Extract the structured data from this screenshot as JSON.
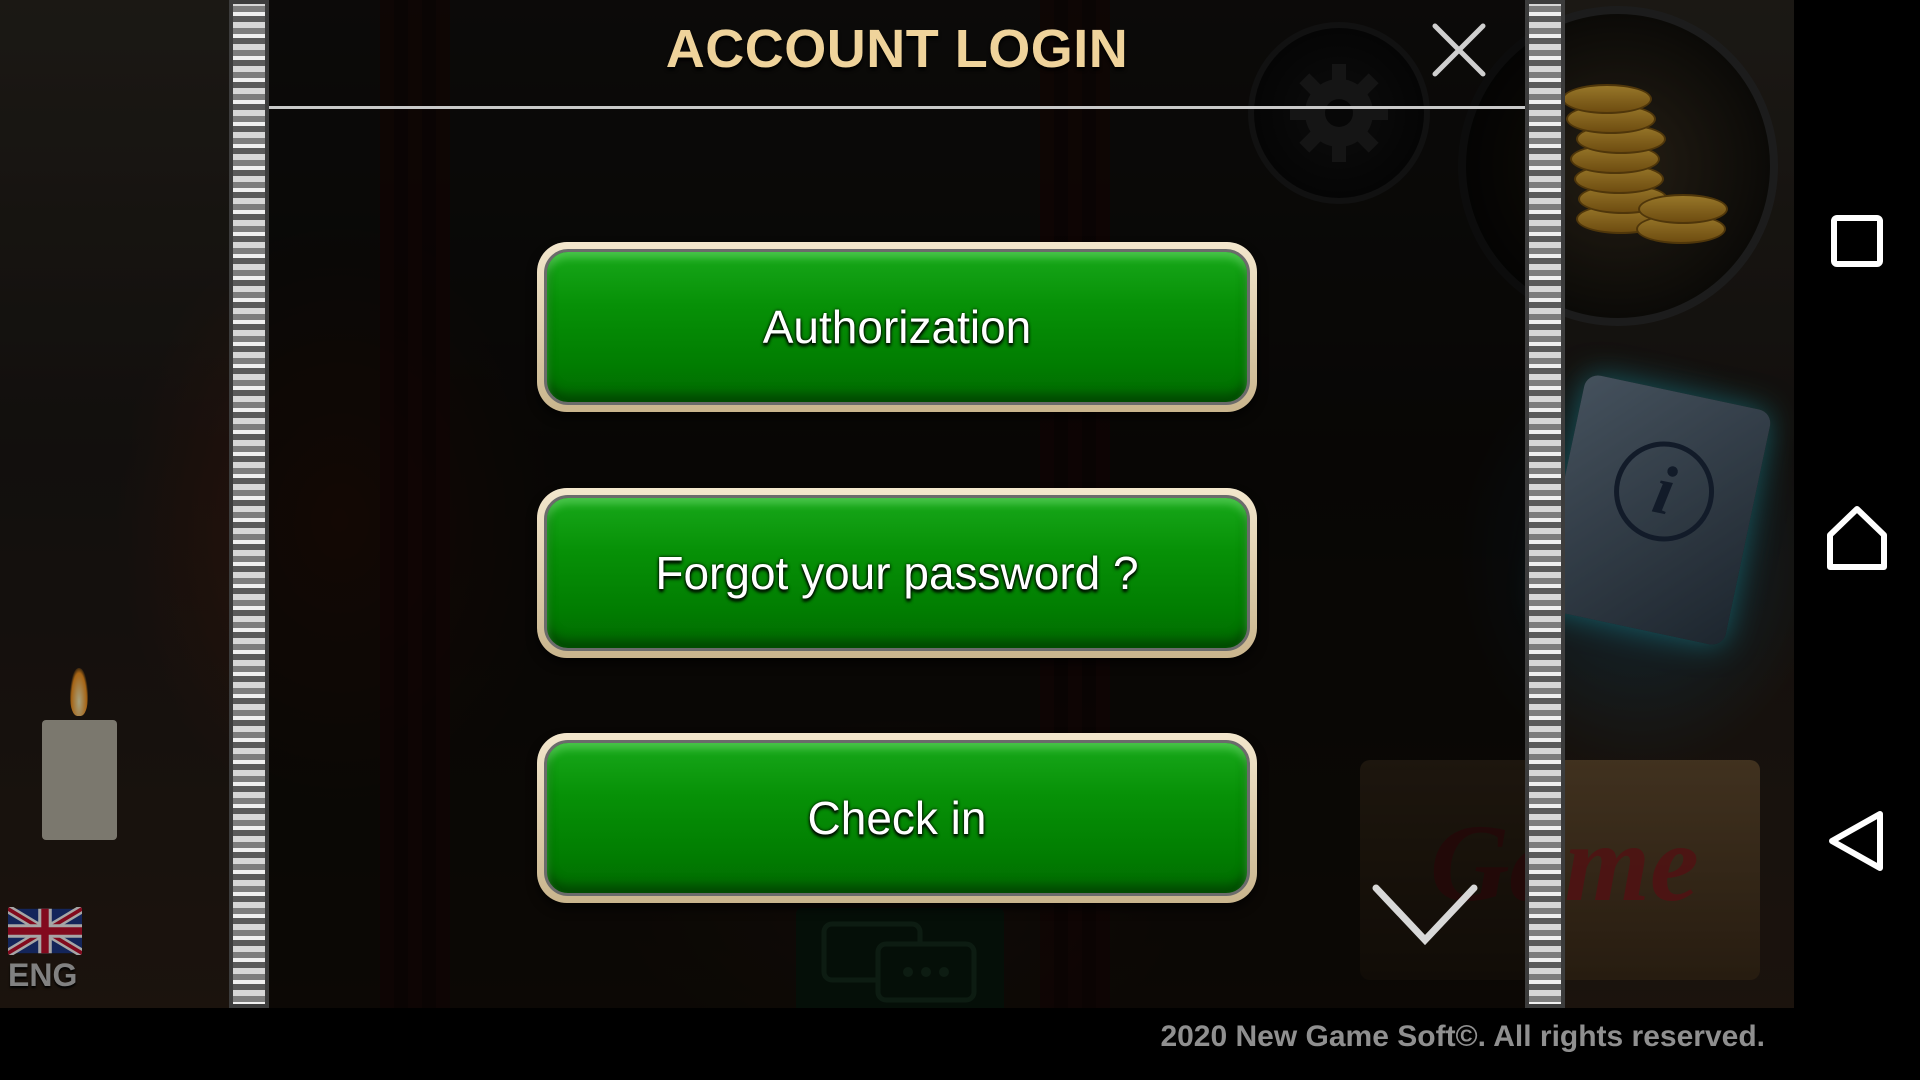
{
  "dialog": {
    "title": "ACCOUNT LOGIN",
    "close_icon": "close-icon",
    "buttons": [
      {
        "label": "Authorization"
      },
      {
        "label": "Forgot your password ?"
      },
      {
        "label": "Check in"
      }
    ]
  },
  "background": {
    "language": {
      "icon": "uk-flag-icon",
      "label": "ENG"
    },
    "settings_icon": "gear-icon",
    "coins_icon": "gold-coins-icon",
    "info_icon": "info-book-icon",
    "chat_icon": "chat-icon",
    "scroll_down_icon": "chevron-down-icon"
  },
  "navigation_bar": {
    "recents_icon": "square-icon",
    "home_icon": "home-icon",
    "back_icon": "back-triangle-icon"
  },
  "footer": {
    "copyright": "2020 New Game Soft©. All rights reserved."
  },
  "colors": {
    "button_green": "#079107",
    "title_gold": "#efd39b",
    "button_border": "#f3e7cd"
  }
}
